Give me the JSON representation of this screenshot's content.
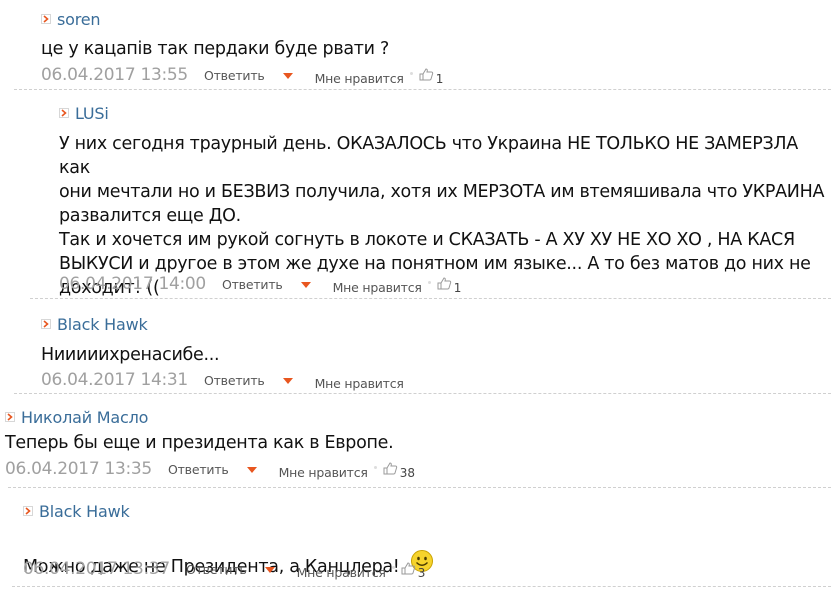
{
  "ui": {
    "reply_label": "Ответить",
    "like_label": "Мне нравится"
  },
  "colors": {
    "author": "#3a6d99",
    "date": "#a0a0a0",
    "dropdown": "#e8561f",
    "smiley": "#f6d32c"
  },
  "comments": [
    {
      "author": "soren",
      "text": "це у кацапів так пердаки буде рвати ?",
      "date": "06.04.2017 13:55",
      "likes": "1"
    },
    {
      "author": "LUSi",
      "text": "У них сегодня траурный день. ОКАЗАЛОСЬ что Украина НЕ ТОЛЬКО НЕ ЗАМЕРЗЛА как\nони мечтали но и БЕЗВИЗ получила, хотя их МЕРЗОТА им втемяшивала что УКРАИНА\nразвалится еще ДО.\nТак и хочется им рукой согнуть в локоте и СКАЗАТЬ - А ХУ ХУ НЕ ХО ХО , НА КАСЯ\nВЫКУСИ и другое в этом же духе на понятном им языке... А то без матов до них не\nдоходит! ((",
      "date": "06.04.2017 14:00",
      "likes": "1"
    },
    {
      "author": "Black Hawk",
      "text": "Нииииихренасибе...",
      "date": "06.04.2017 14:31"
    },
    {
      "author": "Николай Масло",
      "text": "Теперь бы еще и президента как в Европе.",
      "date": "06.04.2017 13:35",
      "likes": "38"
    },
    {
      "author": "Black Hawk",
      "text": "Можно даже не Президента, а Канцлера!",
      "date": "06.04.2017 13:37",
      "likes": "3",
      "emoji": "smiley-icon"
    }
  ]
}
